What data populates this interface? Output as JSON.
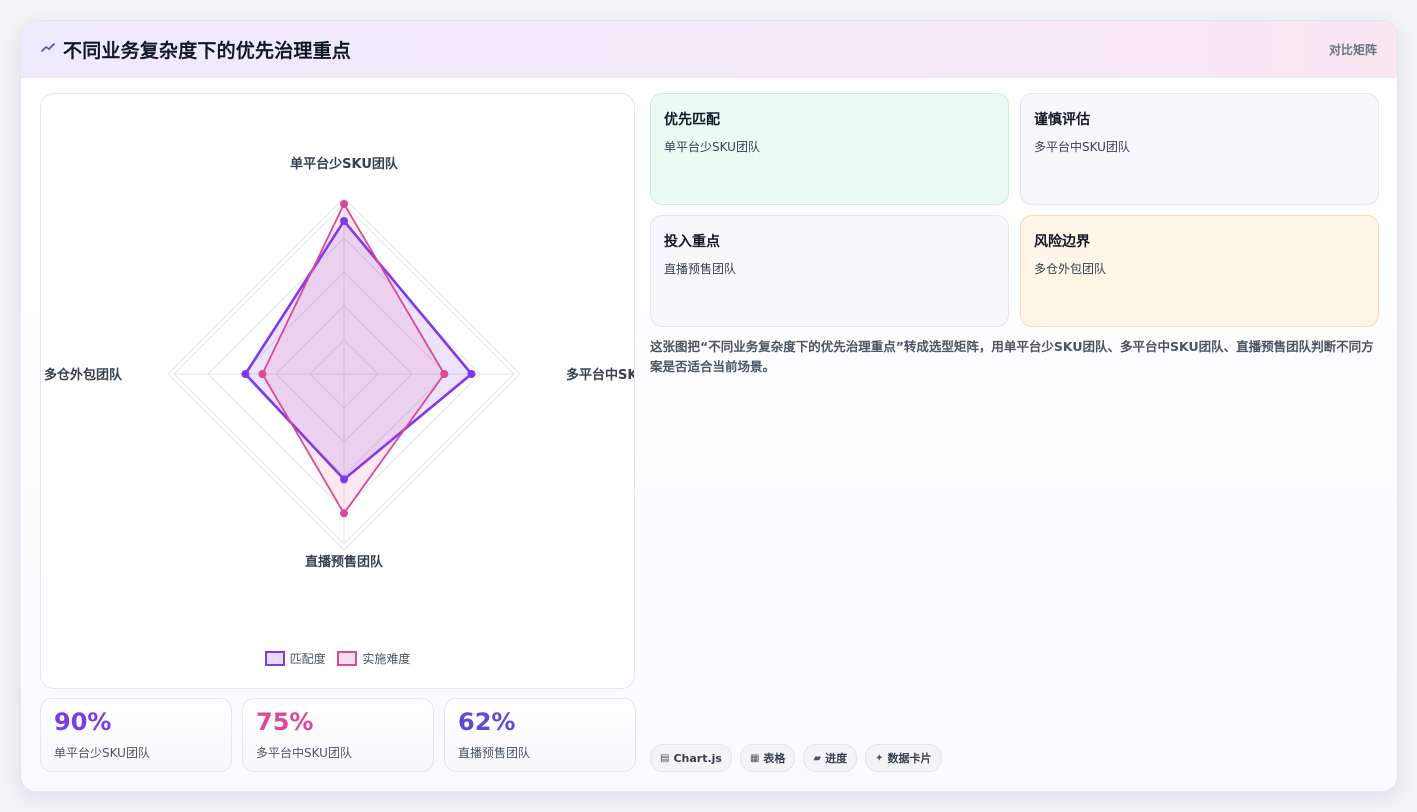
{
  "header": {
    "title": "不同业务复杂度下的优先治理重点",
    "tag": "对比矩阵",
    "icon": "trend-line-icon"
  },
  "chart_data": {
    "type": "radar",
    "categories": [
      "单平台少SKU团队",
      "多平台中SKU团队",
      "直播预售团队",
      "多仓外包团队"
    ],
    "series": [
      {
        "name": "匹配度",
        "values": [
          90,
          75,
          62,
          58
        ],
        "color": "#7c3aed"
      },
      {
        "name": "实施难度",
        "values": [
          100,
          59,
          82,
          48
        ],
        "color": "#db4a97"
      }
    ],
    "range": [
      0,
      100
    ],
    "grid": true,
    "legend_position": "bottom"
  },
  "stats": [
    {
      "value": "90%",
      "label": "单平台少SKU团队",
      "color": "#7c3aed"
    },
    {
      "value": "75%",
      "label": "多平台中SKU团队",
      "color": "#db4a97"
    },
    {
      "value": "62%",
      "label": "直播预售团队",
      "color": "#5b4bd6"
    }
  ],
  "quadrants": [
    {
      "title": "优先匹配",
      "subtitle": "单平台少SKU团队"
    },
    {
      "title": "谨慎评估",
      "subtitle": "多平台中SKU团队"
    },
    {
      "title": "投入重点",
      "subtitle": "直播预售团队"
    },
    {
      "title": "风险边界",
      "subtitle": "多仓外包团队"
    }
  ],
  "description": "这张图把“不同业务复杂度下的优先治理重点”转成选型矩阵，用单平台少SKU团队、多平台中SKU团队、直播预售团队判断不同方案是否适合当前场景。",
  "chips": [
    {
      "icon": "chart-icon",
      "glyph": "▤",
      "label": "Chart.js"
    },
    {
      "icon": "table-icon",
      "glyph": "▦",
      "label": "表格"
    },
    {
      "icon": "progress-icon",
      "glyph": "▰",
      "label": "进度"
    },
    {
      "icon": "card-icon",
      "glyph": "✦",
      "label": "数据卡片"
    }
  ]
}
